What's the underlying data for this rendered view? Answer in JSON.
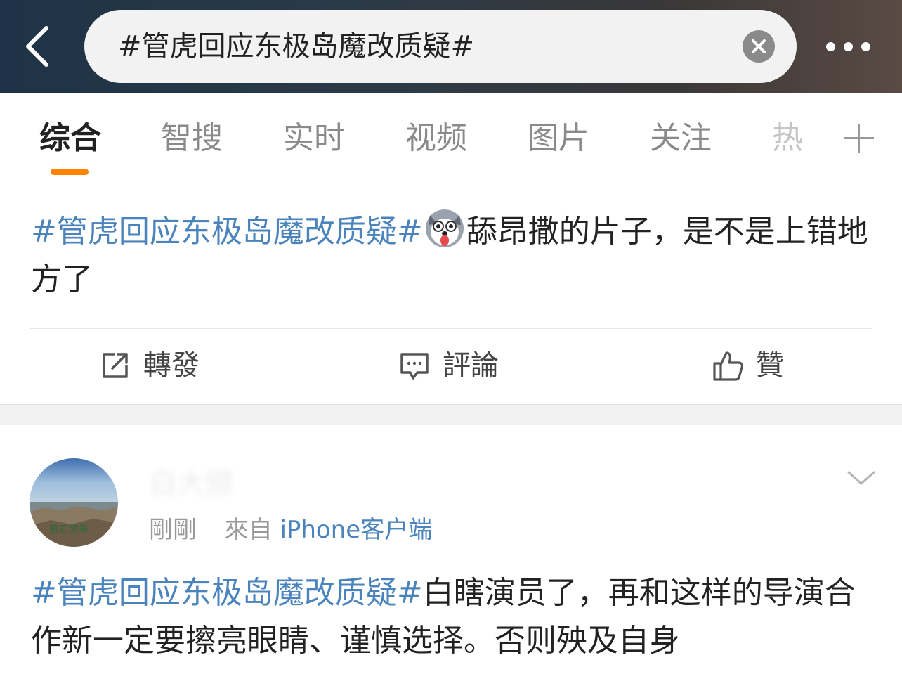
{
  "header": {
    "search_query": "#管虎回应东极岛魔改质疑#"
  },
  "tabs": [
    {
      "label": "综合"
    },
    {
      "label": "智搜"
    },
    {
      "label": "实时"
    },
    {
      "label": "视频"
    },
    {
      "label": "图片"
    },
    {
      "label": "关注"
    },
    {
      "label": "热"
    }
  ],
  "posts": [
    {
      "topic": "#管虎回应东极岛魔改质疑#",
      "text": "舔昂撒的片子，是不是上错地方了",
      "emoji": "husky-dog-emoji",
      "actions": {
        "repost": "轉發",
        "comment": "評論",
        "like": "贊"
      }
    },
    {
      "username": "白大颁",
      "time": "剛剛",
      "source_prefix": "來自",
      "source": "iPhone客户端",
      "avatar_text": "碧石落墨",
      "topic": "#管虎回应东极岛魔改质疑#",
      "text": "白瞎演员了，再和这样的导演合作新一定要擦亮眼睛、谨慎选择。否则殃及自身"
    }
  ],
  "colors": {
    "accent": "#ff8200",
    "link": "#4b84bd"
  }
}
